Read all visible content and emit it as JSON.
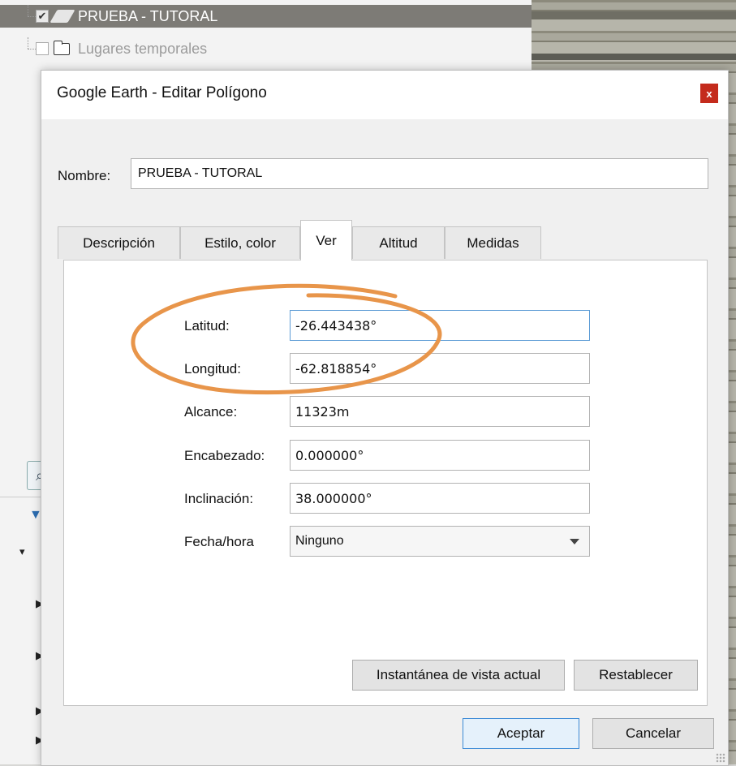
{
  "tree": {
    "items": [
      {
        "label": "PRUEBA - TUTORAL",
        "checked": true,
        "icon": "polygon-icon"
      },
      {
        "label": "Lugares temporales",
        "checked": false,
        "icon": "folder-icon"
      }
    ]
  },
  "dialog": {
    "title": "Google Earth - Editar Polígono",
    "close_label": "x",
    "name_label": "Nombre:",
    "name_value": "PRUEBA - TUTORAL",
    "tabs": [
      {
        "label": "Descripción"
      },
      {
        "label": "Estilo, color"
      },
      {
        "label": "Ver",
        "active": true
      },
      {
        "label": "Altitud"
      },
      {
        "label": "Medidas"
      }
    ],
    "fields": {
      "latitude": {
        "label": "Latitud:",
        "value": "-26.443438°"
      },
      "longitude": {
        "label": "Longitud:",
        "value": "-62.818854°"
      },
      "range": {
        "label": "Alcance:",
        "value": "11323m"
      },
      "heading": {
        "label": "Encabezado:",
        "value": "0.000000°"
      },
      "tilt": {
        "label": "Inclinación:",
        "value": "38.000000°"
      },
      "datetime": {
        "label": "Fecha/hora",
        "value": "Ninguno"
      }
    },
    "snapshot_button": "Instantánea de vista actual",
    "reset_button": "Restablecer",
    "ok_button": "Aceptar",
    "cancel_button": "Cancelar"
  },
  "colors": {
    "accent": "#3c8ad6",
    "close": "#c42b1c",
    "annotation": "#e8954a",
    "selection": "#7d7b76"
  }
}
